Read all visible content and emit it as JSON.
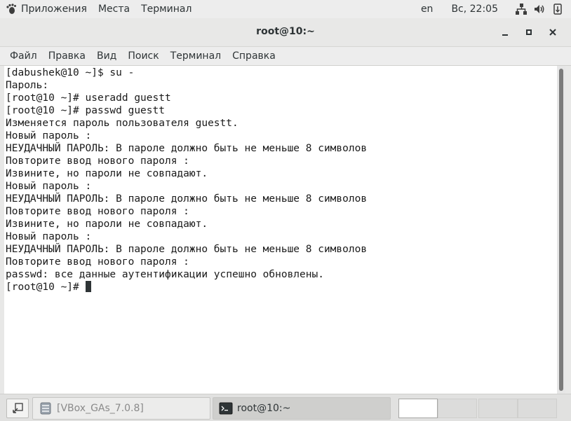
{
  "top_panel": {
    "apps_label": "Приложения",
    "places_label": "Места",
    "terminal_label": "Терминал",
    "keyboard_layout": "en",
    "clock": "Вс, 22:05",
    "icons": [
      "network-icon",
      "volume-icon",
      "power-icon"
    ]
  },
  "window": {
    "title": "root@10:~"
  },
  "menubar": {
    "items": [
      "Файл",
      "Правка",
      "Вид",
      "Поиск",
      "Терминал",
      "Справка"
    ]
  },
  "terminal": {
    "lines": [
      "[dabushek@10 ~]$ su -",
      "Пароль:",
      "[root@10 ~]# useradd guestt",
      "[root@10 ~]# passwd guestt",
      "Изменяется пароль пользователя guestt.",
      "Новый пароль :",
      "НЕУДАЧНЫЙ ПАРОЛЬ: В пароле должно быть не меньше 8 символов",
      "Повторите ввод нового пароля :",
      "Извините, но пароли не совпадают.",
      "Новый пароль :",
      "НЕУДАЧНЫЙ ПАРОЛЬ: В пароле должно быть не меньше 8 символов",
      "Повторите ввод нового пароля :",
      "Извините, но пароли не совпадают.",
      "Новый пароль :",
      "НЕУДАЧНЫЙ ПАРОЛЬ: В пароле должно быть не меньше 8 символов",
      "Повторите ввод нового пароля :",
      "passwd: все данные аутентификации успешно обновлены."
    ],
    "prompt": "[root@10 ~]# "
  },
  "taskbar": {
    "tasks": [
      {
        "label": "[VBox_GAs_7.0.8]",
        "active": false
      },
      {
        "label": "root@10:~",
        "active": true
      }
    ],
    "workspaces": 4,
    "active_workspace": 1
  }
}
